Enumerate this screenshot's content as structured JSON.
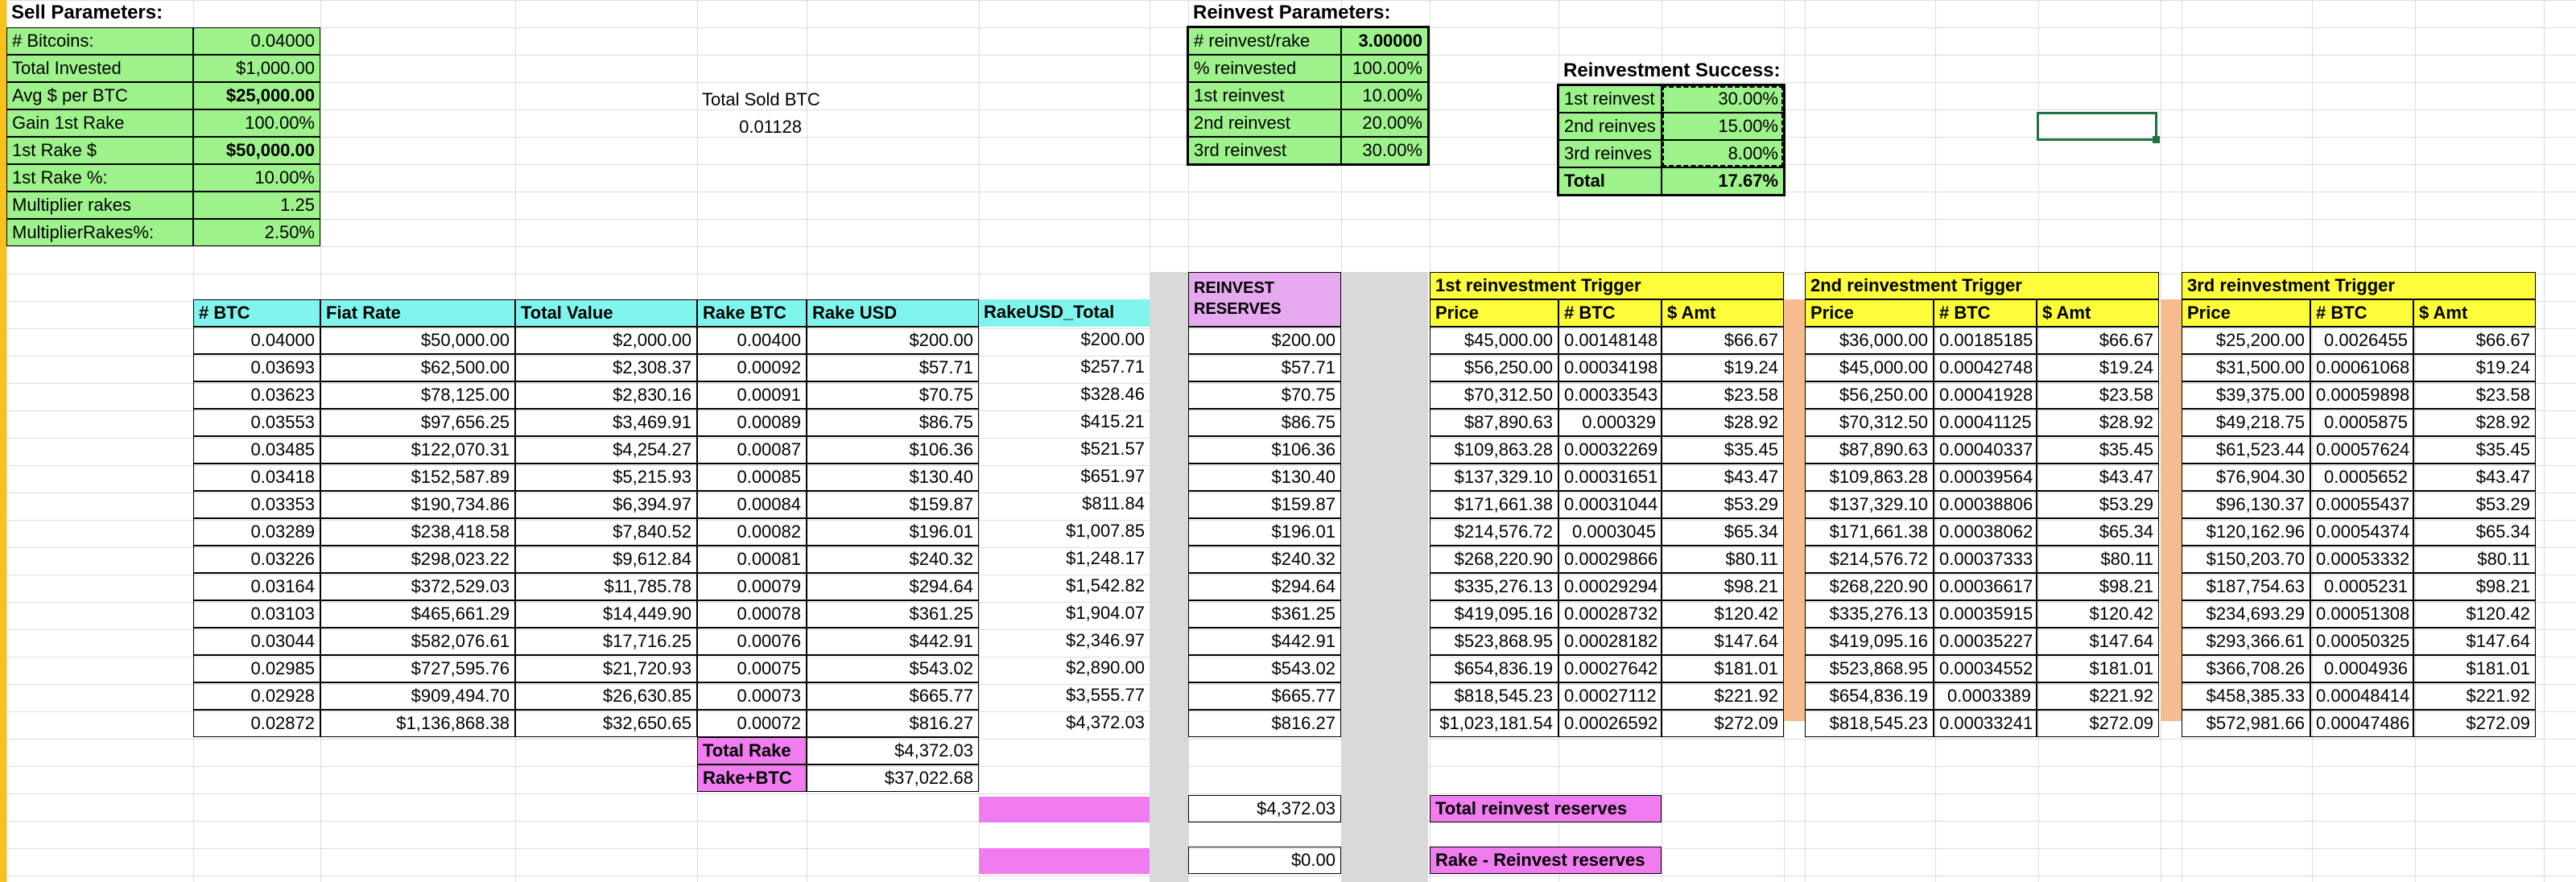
{
  "colors": {
    "green": "#9ef28b",
    "cyan": "#7ff5ee",
    "pink": "#e6a9ef",
    "magenta": "#f07cf0",
    "yellow": "#fdfd3a",
    "gray": "#d9d9d9",
    "peach": "#f6bb8e",
    "left_bar": "#f7c21a"
  },
  "sell": {
    "title": "Sell Parameters:",
    "rows": [
      {
        "label": "# Bitcoins:",
        "value": "0.04000",
        "bold": false
      },
      {
        "label": "Total Invested",
        "value": "$1,000.00",
        "bold": false
      },
      {
        "label": "Avg $ per BTC",
        "value": "$25,000.00",
        "bold": true
      },
      {
        "label": "Gain 1st Rake",
        "value": "100.00%",
        "bold": false
      },
      {
        "label": "1st Rake $",
        "value": "$50,000.00",
        "bold": true
      },
      {
        "label": "1st Rake %:",
        "value": "10.00%",
        "bold": false
      },
      {
        "label": "Multiplier rakes",
        "value": "1.25",
        "bold": false
      },
      {
        "label": "MultiplierRakes%:",
        "value": "2.50%",
        "bold": false
      }
    ]
  },
  "total_sold": {
    "label": "Total Sold BTC",
    "value": "0.01128"
  },
  "reinvest_params": {
    "title": "Reinvest Parameters:",
    "rows": [
      {
        "label": "# reinvest/rake",
        "value": "3.00000",
        "bold": true
      },
      {
        "label": "% reinvested",
        "value": "100.00%",
        "bold": false
      },
      {
        "label": "1st reinvest",
        "value": "10.00%",
        "bold": false
      },
      {
        "label": "2nd reinvest",
        "value": "20.00%",
        "bold": false
      },
      {
        "label": "3rd reinvest",
        "value": "30.00%",
        "bold": false
      }
    ]
  },
  "success": {
    "title": "Reinvestment Success:",
    "rows": [
      {
        "label": "1st reinvest",
        "value": "30.00%"
      },
      {
        "label": "2nd reinves",
        "value": "15.00%"
      },
      {
        "label": "3rd reinves",
        "value": "8.00%"
      }
    ],
    "total_label": "Total",
    "total_value": "17.67%"
  },
  "main_table": {
    "headers": [
      "# BTC",
      "Fiat Rate",
      "Total Value",
      "Rake BTC",
      "Rake USD",
      "RakeUSD_Total"
    ],
    "rows": [
      [
        "0.04000",
        "$50,000.00",
        "$2,000.00",
        "0.00400",
        "$200.00",
        "$200.00"
      ],
      [
        "0.03693",
        "$62,500.00",
        "$2,308.37",
        "0.00092",
        "$57.71",
        "$257.71"
      ],
      [
        "0.03623",
        "$78,125.00",
        "$2,830.16",
        "0.00091",
        "$70.75",
        "$328.46"
      ],
      [
        "0.03553",
        "$97,656.25",
        "$3,469.91",
        "0.00089",
        "$86.75",
        "$415.21"
      ],
      [
        "0.03485",
        "$122,070.31",
        "$4,254.27",
        "0.00087",
        "$106.36",
        "$521.57"
      ],
      [
        "0.03418",
        "$152,587.89",
        "$5,215.93",
        "0.00085",
        "$130.40",
        "$651.97"
      ],
      [
        "0.03353",
        "$190,734.86",
        "$6,394.97",
        "0.00084",
        "$159.87",
        "$811.84"
      ],
      [
        "0.03289",
        "$238,418.58",
        "$7,840.52",
        "0.00082",
        "$196.01",
        "$1,007.85"
      ],
      [
        "0.03226",
        "$298,023.22",
        "$9,612.84",
        "0.00081",
        "$240.32",
        "$1,248.17"
      ],
      [
        "0.03164",
        "$372,529.03",
        "$11,785.78",
        "0.00079",
        "$294.64",
        "$1,542.82"
      ],
      [
        "0.03103",
        "$465,661.29",
        "$14,449.90",
        "0.00078",
        "$361.25",
        "$1,904.07"
      ],
      [
        "0.03044",
        "$582,076.61",
        "$17,716.25",
        "0.00076",
        "$442.91",
        "$2,346.97"
      ],
      [
        "0.02985",
        "$727,595.76",
        "$21,720.93",
        "0.00075",
        "$543.02",
        "$2,890.00"
      ],
      [
        "0.02928",
        "$909,494.70",
        "$26,630.85",
        "0.00073",
        "$665.77",
        "$3,555.77"
      ],
      [
        "0.02872",
        "$1,136,868.38",
        "$32,650.65",
        "0.00072",
        "$816.27",
        "$4,372.03"
      ]
    ],
    "total_rake_label": "Total Rake",
    "total_rake_value": "$4,372.03",
    "rake_btc_label": "Rake+BTC",
    "rake_btc_value": "$37,022.68"
  },
  "reserves": {
    "header": "REINVEST RESERVES",
    "values": [
      "$200.00",
      "$57.71",
      "$70.75",
      "$86.75",
      "$106.36",
      "$130.40",
      "$159.87",
      "$196.01",
      "$240.32",
      "$294.64",
      "$361.25",
      "$442.91",
      "$543.02",
      "$665.77",
      "$816.27"
    ],
    "total": "$4,372.03",
    "remaining": "$0.00",
    "total_label": "Total reinvest reserves",
    "remaining_label": "Rake - Reinvest reserves"
  },
  "triggers": [
    {
      "title": "1st reinvestment Trigger",
      "headers": [
        "Price",
        "# BTC",
        "$ Amt"
      ],
      "rows": [
        [
          "$45,000.00",
          "0.00148148",
          "$66.67"
        ],
        [
          "$56,250.00",
          "0.00034198",
          "$19.24"
        ],
        [
          "$70,312.50",
          "0.00033543",
          "$23.58"
        ],
        [
          "$87,890.63",
          "0.000329",
          "$28.92"
        ],
        [
          "$109,863.28",
          "0.00032269",
          "$35.45"
        ],
        [
          "$137,329.10",
          "0.00031651",
          "$43.47"
        ],
        [
          "$171,661.38",
          "0.00031044",
          "$53.29"
        ],
        [
          "$214,576.72",
          "0.0003045",
          "$65.34"
        ],
        [
          "$268,220.90",
          "0.00029866",
          "$80.11"
        ],
        [
          "$335,276.13",
          "0.00029294",
          "$98.21"
        ],
        [
          "$419,095.16",
          "0.00028732",
          "$120.42"
        ],
        [
          "$523,868.95",
          "0.00028182",
          "$147.64"
        ],
        [
          "$654,836.19",
          "0.00027642",
          "$181.01"
        ],
        [
          "$818,545.23",
          "0.00027112",
          "$221.92"
        ],
        [
          "$1,023,181.54",
          "0.00026592",
          "$272.09"
        ]
      ]
    },
    {
      "title": "2nd reinvestment Trigger",
      "headers": [
        "Price",
        "# BTC",
        "$ Amt"
      ],
      "rows": [
        [
          "$36,000.00",
          "0.00185185",
          "$66.67"
        ],
        [
          "$45,000.00",
          "0.00042748",
          "$19.24"
        ],
        [
          "$56,250.00",
          "0.00041928",
          "$23.58"
        ],
        [
          "$70,312.50",
          "0.00041125",
          "$28.92"
        ],
        [
          "$87,890.63",
          "0.00040337",
          "$35.45"
        ],
        [
          "$109,863.28",
          "0.00039564",
          "$43.47"
        ],
        [
          "$137,329.10",
          "0.00038806",
          "$53.29"
        ],
        [
          "$171,661.38",
          "0.00038062",
          "$65.34"
        ],
        [
          "$214,576.72",
          "0.00037333",
          "$80.11"
        ],
        [
          "$268,220.90",
          "0.00036617",
          "$98.21"
        ],
        [
          "$335,276.13",
          "0.00035915",
          "$120.42"
        ],
        [
          "$419,095.16",
          "0.00035227",
          "$147.64"
        ],
        [
          "$523,868.95",
          "0.00034552",
          "$181.01"
        ],
        [
          "$654,836.19",
          "0.0003389",
          "$221.92"
        ],
        [
          "$818,545.23",
          "0.00033241",
          "$272.09"
        ]
      ]
    },
    {
      "title": "3rd reinvestment Trigger",
      "headers": [
        "Price",
        "# BTC",
        "$ Amt"
      ],
      "rows": [
        [
          "$25,200.00",
          "0.0026455",
          "$66.67"
        ],
        [
          "$31,500.00",
          "0.00061068",
          "$19.24"
        ],
        [
          "$39,375.00",
          "0.00059898",
          "$23.58"
        ],
        [
          "$49,218.75",
          "0.0005875",
          "$28.92"
        ],
        [
          "$61,523.44",
          "0.00057624",
          "$35.45"
        ],
        [
          "$76,904.30",
          "0.0005652",
          "$43.47"
        ],
        [
          "$96,130.37",
          "0.00055437",
          "$53.29"
        ],
        [
          "$120,162.96",
          "0.00054374",
          "$65.34"
        ],
        [
          "$150,203.70",
          "0.00053332",
          "$80.11"
        ],
        [
          "$187,754.63",
          "0.0005231",
          "$98.21"
        ],
        [
          "$234,693.29",
          "0.00051308",
          "$120.42"
        ],
        [
          "$293,366.61",
          "0.00050325",
          "$147.64"
        ],
        [
          "$366,708.26",
          "0.0004936",
          "$181.01"
        ],
        [
          "$458,385.33",
          "0.00048414",
          "$221.92"
        ],
        [
          "$572,981.66",
          "0.00047486",
          "$272.09"
        ]
      ]
    }
  ]
}
